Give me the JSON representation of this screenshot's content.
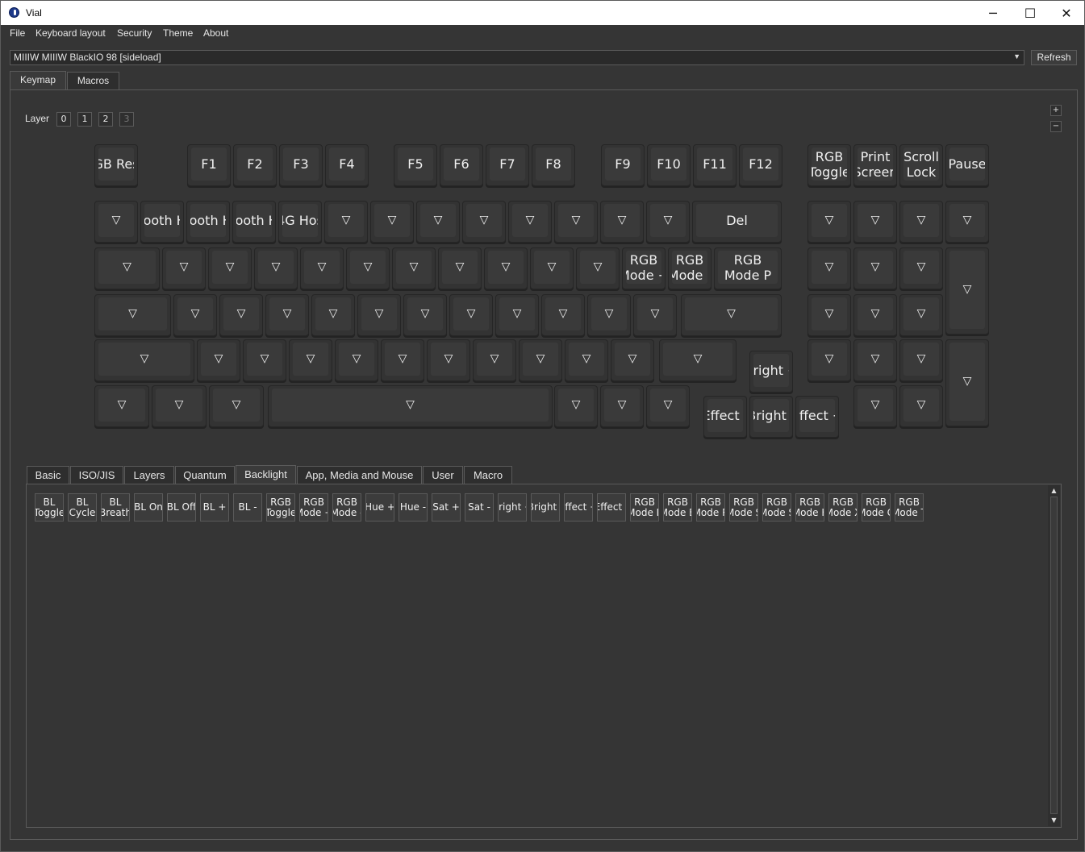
{
  "window": {
    "title": "Vial",
    "minimize": "─",
    "maximize": "☐",
    "close": "✕"
  },
  "menu": [
    "File",
    "Keyboard layout",
    "Security",
    "Theme",
    "About"
  ],
  "device": {
    "selected": "MIIIW MIIIW BlackIO 98 [sideload]",
    "refresh_label": "Refresh"
  },
  "main_tabs": [
    "Keymap",
    "Macros"
  ],
  "layers": {
    "label": "Layer",
    "buttons": [
      "0",
      "1",
      "2",
      "3"
    ]
  },
  "zoom": {
    "plus": "+",
    "minus": "−"
  },
  "keys": {
    "k0": "GB Res",
    "k1": "F1",
    "k2": "F2",
    "k3": "F3",
    "k4": "F4",
    "k5": "F5",
    "k6": "F6",
    "k7": "F7",
    "k8": "F8",
    "k9": "F9",
    "k10": "F10",
    "k11": "F11",
    "k12": "F12",
    "k13": "RGB\nToggle",
    "k14": "Print\nScreen",
    "k15": "Scroll\nLock",
    "k16": "Pause",
    "r2_0": "▽",
    "r2_1": "tooth H",
    "r2_2": "tooth H",
    "r2_3": "tooth H",
    "r2_4": "4G Hos",
    "r2_5": "▽",
    "r2_6": "▽",
    "r2_7": "▽",
    "r2_8": "▽",
    "r2_9": "▽",
    "r2_10": "▽",
    "r2_11": "▽",
    "r2_12": "▽",
    "r2_13": "Del",
    "r2_14": "▽",
    "r2_15": "▽",
    "r2_16": "▽",
    "r2_17": "▽",
    "r3_0": "▽",
    "r3_1": "▽",
    "r3_2": "▽",
    "r3_3": "▽",
    "r3_4": "▽",
    "r3_5": "▽",
    "r3_6": "▽",
    "r3_7": "▽",
    "r3_8": "▽",
    "r3_9": "▽",
    "r3_10": "▽",
    "r3_11": "RGB\nMode +",
    "r3_12": "RGB\nMode -",
    "r3_13": "RGB\nMode P",
    "r3_14": "▽",
    "r3_15": "▽",
    "r3_16": "▽",
    "r3_17": "▽",
    "r4_0": "▽",
    "r4_1": "▽",
    "r4_2": "▽",
    "r4_3": "▽",
    "r4_4": "▽",
    "r4_5": "▽",
    "r4_6": "▽",
    "r4_7": "▽",
    "r4_8": "▽",
    "r4_9": "▽",
    "r4_10": "▽",
    "r4_11": "▽",
    "r4_12": "▽",
    "r4_13": "▽",
    "r4_14": "▽",
    "r4_15": "▽",
    "r5_0": "▽",
    "r5_1": "▽",
    "r5_2": "▽",
    "r5_3": "▽",
    "r5_4": "▽",
    "r5_5": "▽",
    "r5_6": "▽",
    "r5_7": "▽",
    "r5_8": "▽",
    "r5_9": "▽",
    "r5_10": "▽",
    "r5_11": "▽",
    "r5_12": "Bright +",
    "r5_13": "▽",
    "r5_14": "▽",
    "r5_15": "▽",
    "r5_16": "▽",
    "r6_0": "▽",
    "r6_1": "▽",
    "r6_2": "▽",
    "r6_3": "▽",
    "r6_4": "▽",
    "r6_5": "▽",
    "r6_6": "▽",
    "r6_7": "Effect -",
    "r6_8": "Bright -",
    "r6_9": "Effect +",
    "r6_10": "▽",
    "r6_11": "▽"
  },
  "sub_tabs": [
    "Basic",
    "ISO/JIS",
    "Layers",
    "Quantum",
    "Backlight",
    "App, Media and Mouse",
    "User",
    "Macro"
  ],
  "keycodes": [
    "BL\nToggle",
    "BL\nCycle",
    "BL\nBreath",
    "BL On",
    "BL Off",
    "BL +",
    "BL -",
    "RGB\nToggle",
    "RGB\nMode +",
    "RGB\nMode -",
    "Hue +",
    "Hue -",
    "Sat +",
    "Sat -",
    "Bright +",
    "Bright -",
    "Effect +",
    "Effect -",
    "RGB\nMode P",
    "RGB\nMode B",
    "RGB\nMode R",
    "RGB\nMode S",
    "RGB\nMode S",
    "RGB\nMode K",
    "RGB\nMode X",
    "RGB\nMode G",
    "RGB\nMode T"
  ]
}
